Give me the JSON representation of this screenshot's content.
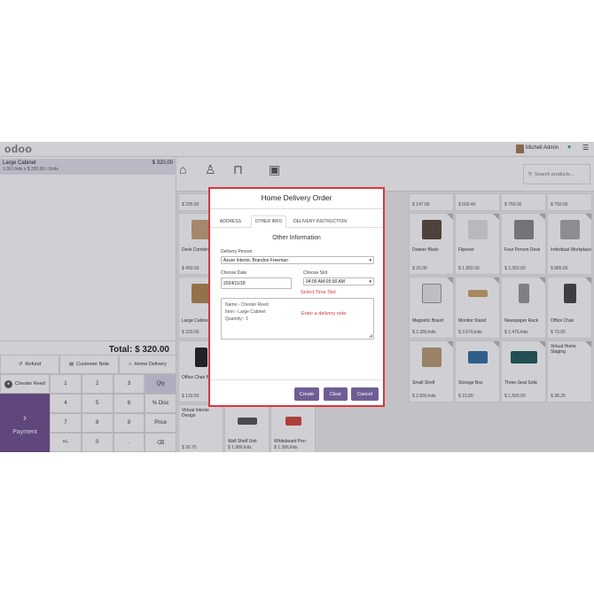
{
  "app": {
    "logo": "odoo",
    "user_name": "Michell Admin"
  },
  "order": {
    "line_name": "Large Cabinet",
    "line_price": "$ 320.00",
    "line_detail": "1.00  Units x $ 320.00 / Units",
    "total": "Total: $ 320.00"
  },
  "controls": {
    "refund": "Refund",
    "customer_note": "Customer Note",
    "home_delivery": "Home Delivery"
  },
  "customer": {
    "name": "Chester Reed"
  },
  "payment": {
    "label": "Payment"
  },
  "numpad": [
    "1",
    "2",
    "3",
    "Qty",
    "4",
    "5",
    "6",
    "% Disc",
    "7",
    "8",
    "9",
    "Price",
    "+/-",
    "0",
    ".",
    "⌫"
  ],
  "search": {
    "placeholder": "Search products..."
  },
  "products": [
    {
      "name": "",
      "price": "$ 295.00"
    },
    {
      "name": "",
      "price": "$ 147.00"
    },
    {
      "name": "",
      "price": "$ 600.40"
    },
    {
      "name": "",
      "price": "$ 750.00"
    },
    {
      "name": "",
      "price": "$ 750.00"
    },
    {
      "name": "Desk Combination",
      "price": "$ 450.00"
    },
    {
      "name": "Drawer Black",
      "price": "$ 25.00"
    },
    {
      "name": "Flipover",
      "price": "$ 1,950.00"
    },
    {
      "name": "Four Person Desk",
      "price": "$ 2,350.00"
    },
    {
      "name": "Individual Workplace",
      "price": "$ 885.00"
    },
    {
      "name": "Large Cabinet",
      "price": "$ 320.00"
    },
    {
      "name": "Magnetic Board",
      "price": "$ 2.28/Units"
    },
    {
      "name": "Monitor Stand",
      "price": "$ 3.67/Units"
    },
    {
      "name": "Newspaper Rack",
      "price": "$ 1.47/Units"
    },
    {
      "name": "Office Chair",
      "price": "$ 70.00"
    },
    {
      "name": "Office Chair Black",
      "price": "$ 120.50"
    },
    {
      "name": "Small Shelf",
      "price": "$ 2.83/Units"
    },
    {
      "name": "Storage Box",
      "price": "$ 15.80"
    },
    {
      "name": "Three-Seat Sofa",
      "price": "$ 1,500.00"
    },
    {
      "name": "Virtual Home Staging",
      "price": "$ 38.25"
    },
    {
      "name": "Virtual Interior Design",
      "price": "$ 30.75"
    },
    {
      "name": "Wall Shelf Unit",
      "price": "$ 1.98/Units"
    },
    {
      "name": "Whiteboard Pen",
      "price": "$ 1.38/Units"
    }
  ],
  "dialog": {
    "title": "Home Delivery Order",
    "tabs": [
      "ADDRESS",
      "OTHER INFO",
      "DELIVERY INSTRUCTION"
    ],
    "section_title": "Other Information",
    "delivery_person_label": "Delivery Person:",
    "delivery_person_value": "Azure Interior, Brandon Freeman",
    "choose_date_label": "Choose Date",
    "date_value": "2024/11/18",
    "choose_slot_label": "Choose Slot",
    "slot_value": "04:00 AM-05:00 AM",
    "slot_hint": "Select Time Slot",
    "note_lines": [
      "Name:- Chester Reed",
      "Item:- Large Cabinet",
      "Quantity:- 1"
    ],
    "note_hint": "Enter a delivery note",
    "create": "Create",
    "clear": "Clear",
    "cancel": "Cancel"
  },
  "colors": {
    "accent": "#6f5e95",
    "hint": "#d9363e",
    "payment": "#6f4f8f"
  }
}
